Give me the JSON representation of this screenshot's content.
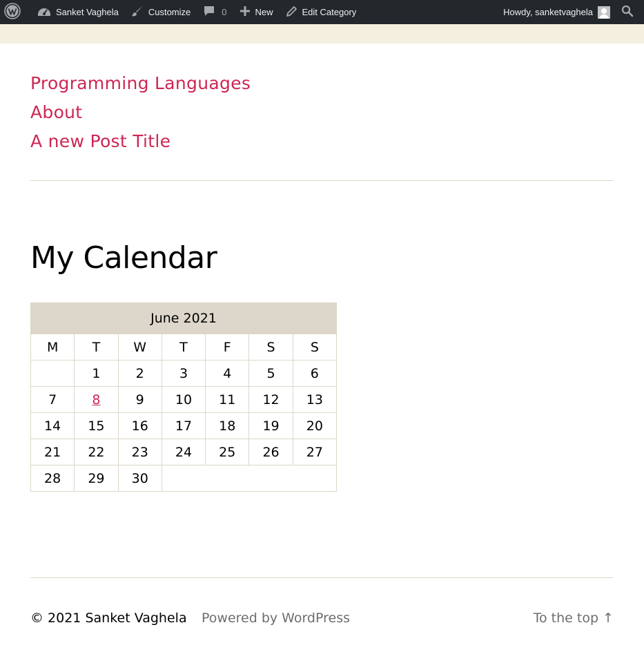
{
  "adminbar": {
    "site_name": "Sanket Vaghela",
    "customize": "Customize",
    "comments_count": "0",
    "new": "New",
    "edit_category": "Edit Category",
    "howdy": "Howdy, sanketvaghela"
  },
  "menu": {
    "items": [
      {
        "label": "Programming Languages"
      },
      {
        "label": "About"
      },
      {
        "label": "A new Post Title"
      }
    ]
  },
  "widget": {
    "title": "My Calendar"
  },
  "calendar": {
    "caption": "June 2021",
    "weekdays": [
      "M",
      "T",
      "W",
      "T",
      "F",
      "S",
      "S"
    ],
    "weeks": [
      [
        "",
        "1",
        "2",
        "3",
        "4",
        "5",
        "6"
      ],
      [
        "7",
        "8",
        "9",
        "10",
        "11",
        "12",
        "13"
      ],
      [
        "14",
        "15",
        "16",
        "17",
        "18",
        "19",
        "20"
      ],
      [
        "21",
        "22",
        "23",
        "24",
        "25",
        "26",
        "27"
      ],
      [
        "28",
        "29",
        "30",
        "",
        "",
        "",
        ""
      ]
    ],
    "linked_day": "8"
  },
  "footer": {
    "copyright": "© 2021",
    "site_name": "Sanket Vaghela",
    "powered_by": "Powered by WordPress",
    "to_top": "To the top ↑"
  },
  "colors": {
    "accent": "#cd2653",
    "adminbar_bg": "#23282d",
    "border": "#dcd7ca",
    "caption_bg": "#dcd7ca",
    "notice_bg": "#f5efe0"
  },
  "icons": {
    "wordpress": "wordpress-logo-icon",
    "dashboard": "dashboard-icon",
    "customize": "paintbrush-icon",
    "comments": "comment-bubble-icon",
    "new": "plus-icon",
    "edit": "pencil-icon",
    "search": "search-icon"
  }
}
